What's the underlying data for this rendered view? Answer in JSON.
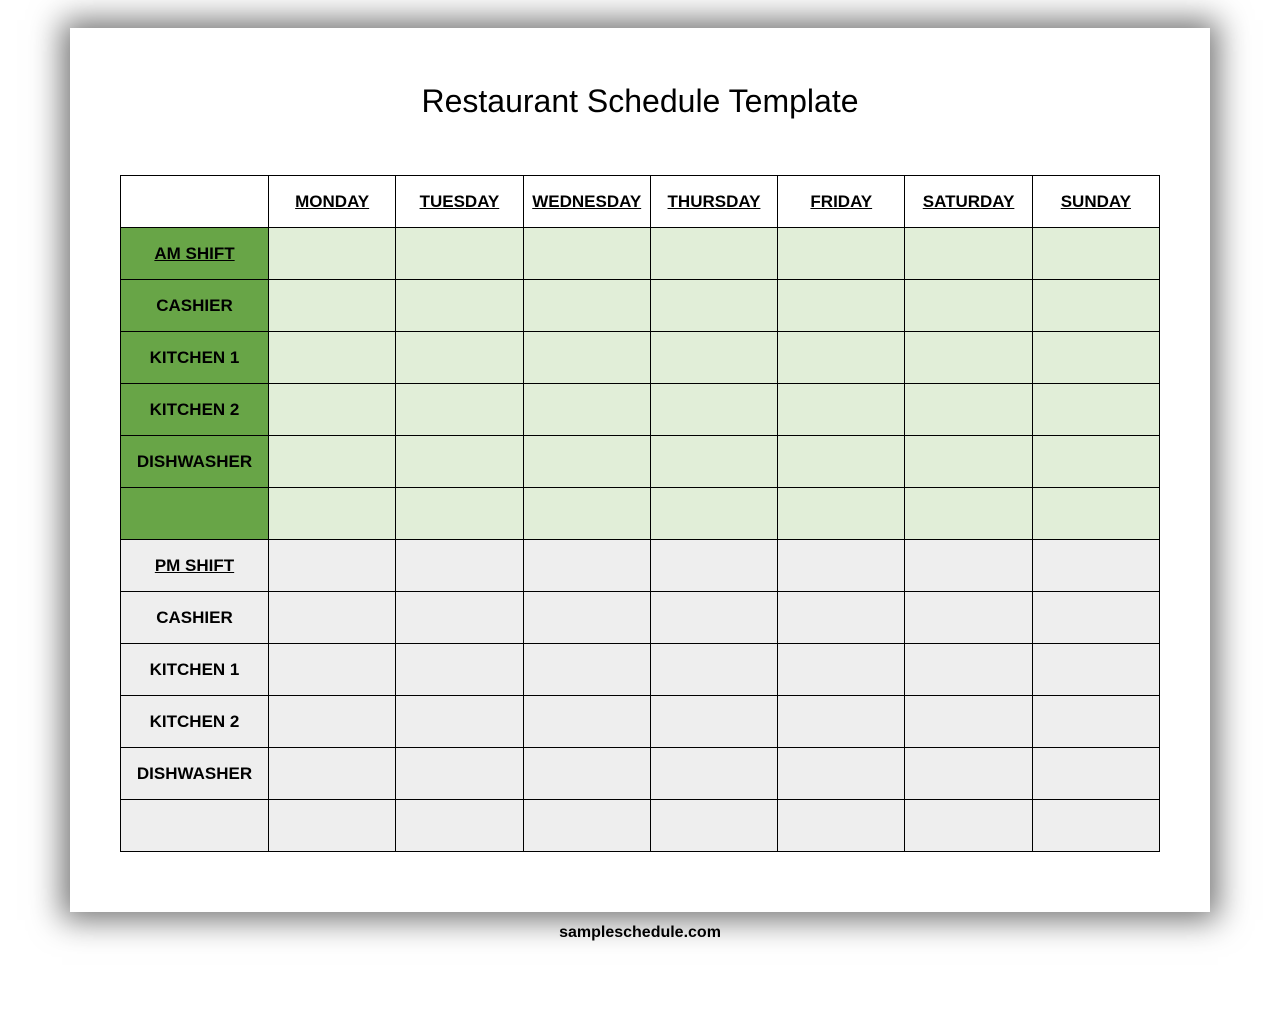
{
  "title": "Restaurant Schedule Template",
  "headers": {
    "blank": "",
    "mon": "MONDAY",
    "tue": "TUESDAY",
    "wed": "WEDNESDAY",
    "thu": "THURSDAY",
    "fri": "FRIDAY",
    "sat": "SATURDAY",
    "sun": "SUNDAY"
  },
  "am": {
    "shift_label": "AM SHIFT",
    "roles": {
      "cashier": "CASHIER",
      "kitchen1": "KITCHEN 1",
      "kitchen2": "KITCHEN 2",
      "dishwasher": "DISHWASHER",
      "blank": ""
    }
  },
  "pm": {
    "shift_label": "PM SHIFT",
    "roles": {
      "cashier": "CASHIER",
      "kitchen1": "KITCHEN 1",
      "kitchen2": "KITCHEN 2",
      "dishwasher": "DISHWASHER",
      "blank": ""
    }
  },
  "footer": "sampleschedule.com"
}
